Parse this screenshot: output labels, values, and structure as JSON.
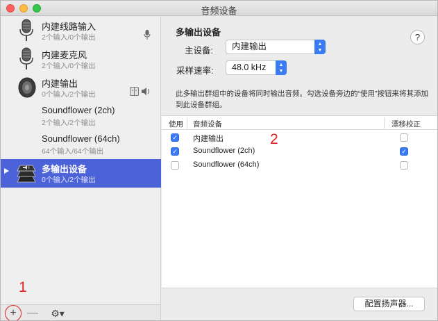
{
  "window": {
    "title": "音频设备"
  },
  "devices": [
    {
      "name": "内建线路输入",
      "sub": "2个输入/0个输出",
      "icon": "microphone-icon",
      "right_icon": "microphone-small-icon"
    },
    {
      "name": "内建麦克风",
      "sub": "2个输入/0个输出",
      "icon": "microphone-icon"
    },
    {
      "name": "内建输出",
      "sub": "0个输入/2个输出",
      "icon": "speaker-icon",
      "right_icon": "finder-speaker-icon"
    },
    {
      "name": "Soundflower (2ch)",
      "sub": "2个输入/2个输出"
    },
    {
      "name": "Soundflower (64ch)",
      "sub": "64个输入/64个输出"
    },
    {
      "name": "多输出设备",
      "sub": "0个输入/2个输出",
      "icon": "multi-output-icon",
      "selected": true
    }
  ],
  "bottombar": {
    "add": "+",
    "remove": "—",
    "gear": "⚙▾"
  },
  "annotations": {
    "one": "1",
    "two": "2"
  },
  "detail": {
    "title": "多输出设备",
    "help": "?",
    "master_label": "主设备:",
    "master_value": "内建输出",
    "rate_label": "采样速率:",
    "rate_value": "48.0 kHz",
    "description": "此多输出群组中的设备将同时输出音频。勾选设备旁边的“使用”按钮来将其添加到此设备群组。"
  },
  "table": {
    "headers": {
      "use": "使用",
      "device": "音频设备",
      "drift": "漂移校正"
    },
    "rows": [
      {
        "name": "内建输出",
        "use": true,
        "drift": false
      },
      {
        "name": "Soundflower (2ch)",
        "use": true,
        "drift": true
      },
      {
        "name": "Soundflower (64ch)",
        "use": false,
        "drift": false
      }
    ]
  },
  "configure_button": "配置扬声器...",
  "colors": {
    "selection": "#4b62d9",
    "accent": "#3a7af3",
    "annotation": "#e02020"
  }
}
